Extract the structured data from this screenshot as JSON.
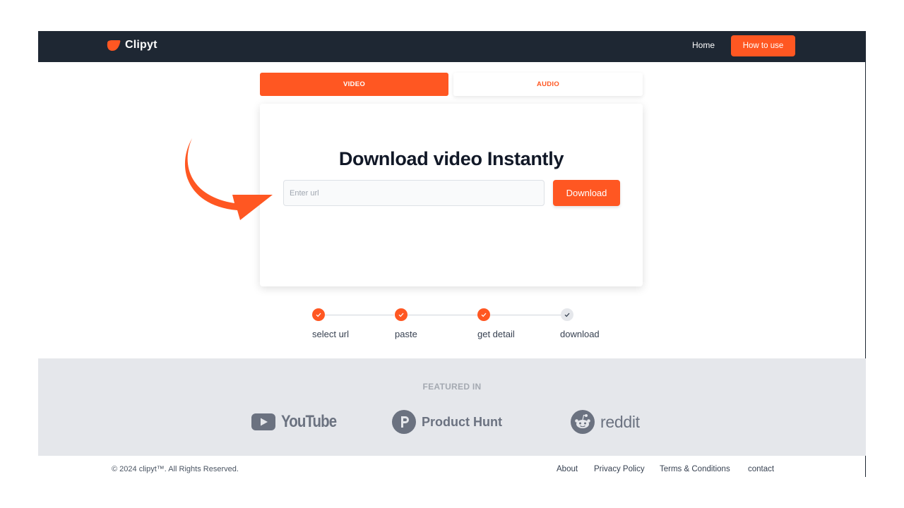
{
  "header": {
    "brand": "Clipyt",
    "nav": {
      "home": "Home",
      "how_to_use": "How to use"
    }
  },
  "tabs": [
    {
      "label": "VIDEO",
      "active": true
    },
    {
      "label": "AUDIO",
      "active": false
    }
  ],
  "card": {
    "title": "Download video Instantly",
    "url_input": {
      "value": "",
      "placeholder": "Enter url"
    },
    "download_label": "Download"
  },
  "steps": [
    {
      "label": "select url",
      "done": true
    },
    {
      "label": "paste",
      "done": true
    },
    {
      "label": "get detail",
      "done": true
    },
    {
      "label": "download",
      "done": false
    }
  ],
  "featured": {
    "title": "FEATURED IN",
    "brands": [
      "YouTube",
      "Product Hunt",
      "reddit"
    ]
  },
  "footer": {
    "copyright": "© 2024 clipyt™. All Rights Reserved.",
    "links": [
      "About",
      "Privacy Policy",
      "Terms & Conditions",
      "contact"
    ]
  },
  "colors": {
    "accent": "#ff5722",
    "header_bg": "#1e2733",
    "featured_bg": "#e5e7eb",
    "brand_gray": "#6b7280"
  },
  "icons": {
    "logo": "clipyt-logo-icon",
    "step_done": "check-icon",
    "youtube": "youtube-icon",
    "producthunt": "product-hunt-icon",
    "reddit": "reddit-icon",
    "arrow": "curved-arrow-icon"
  }
}
